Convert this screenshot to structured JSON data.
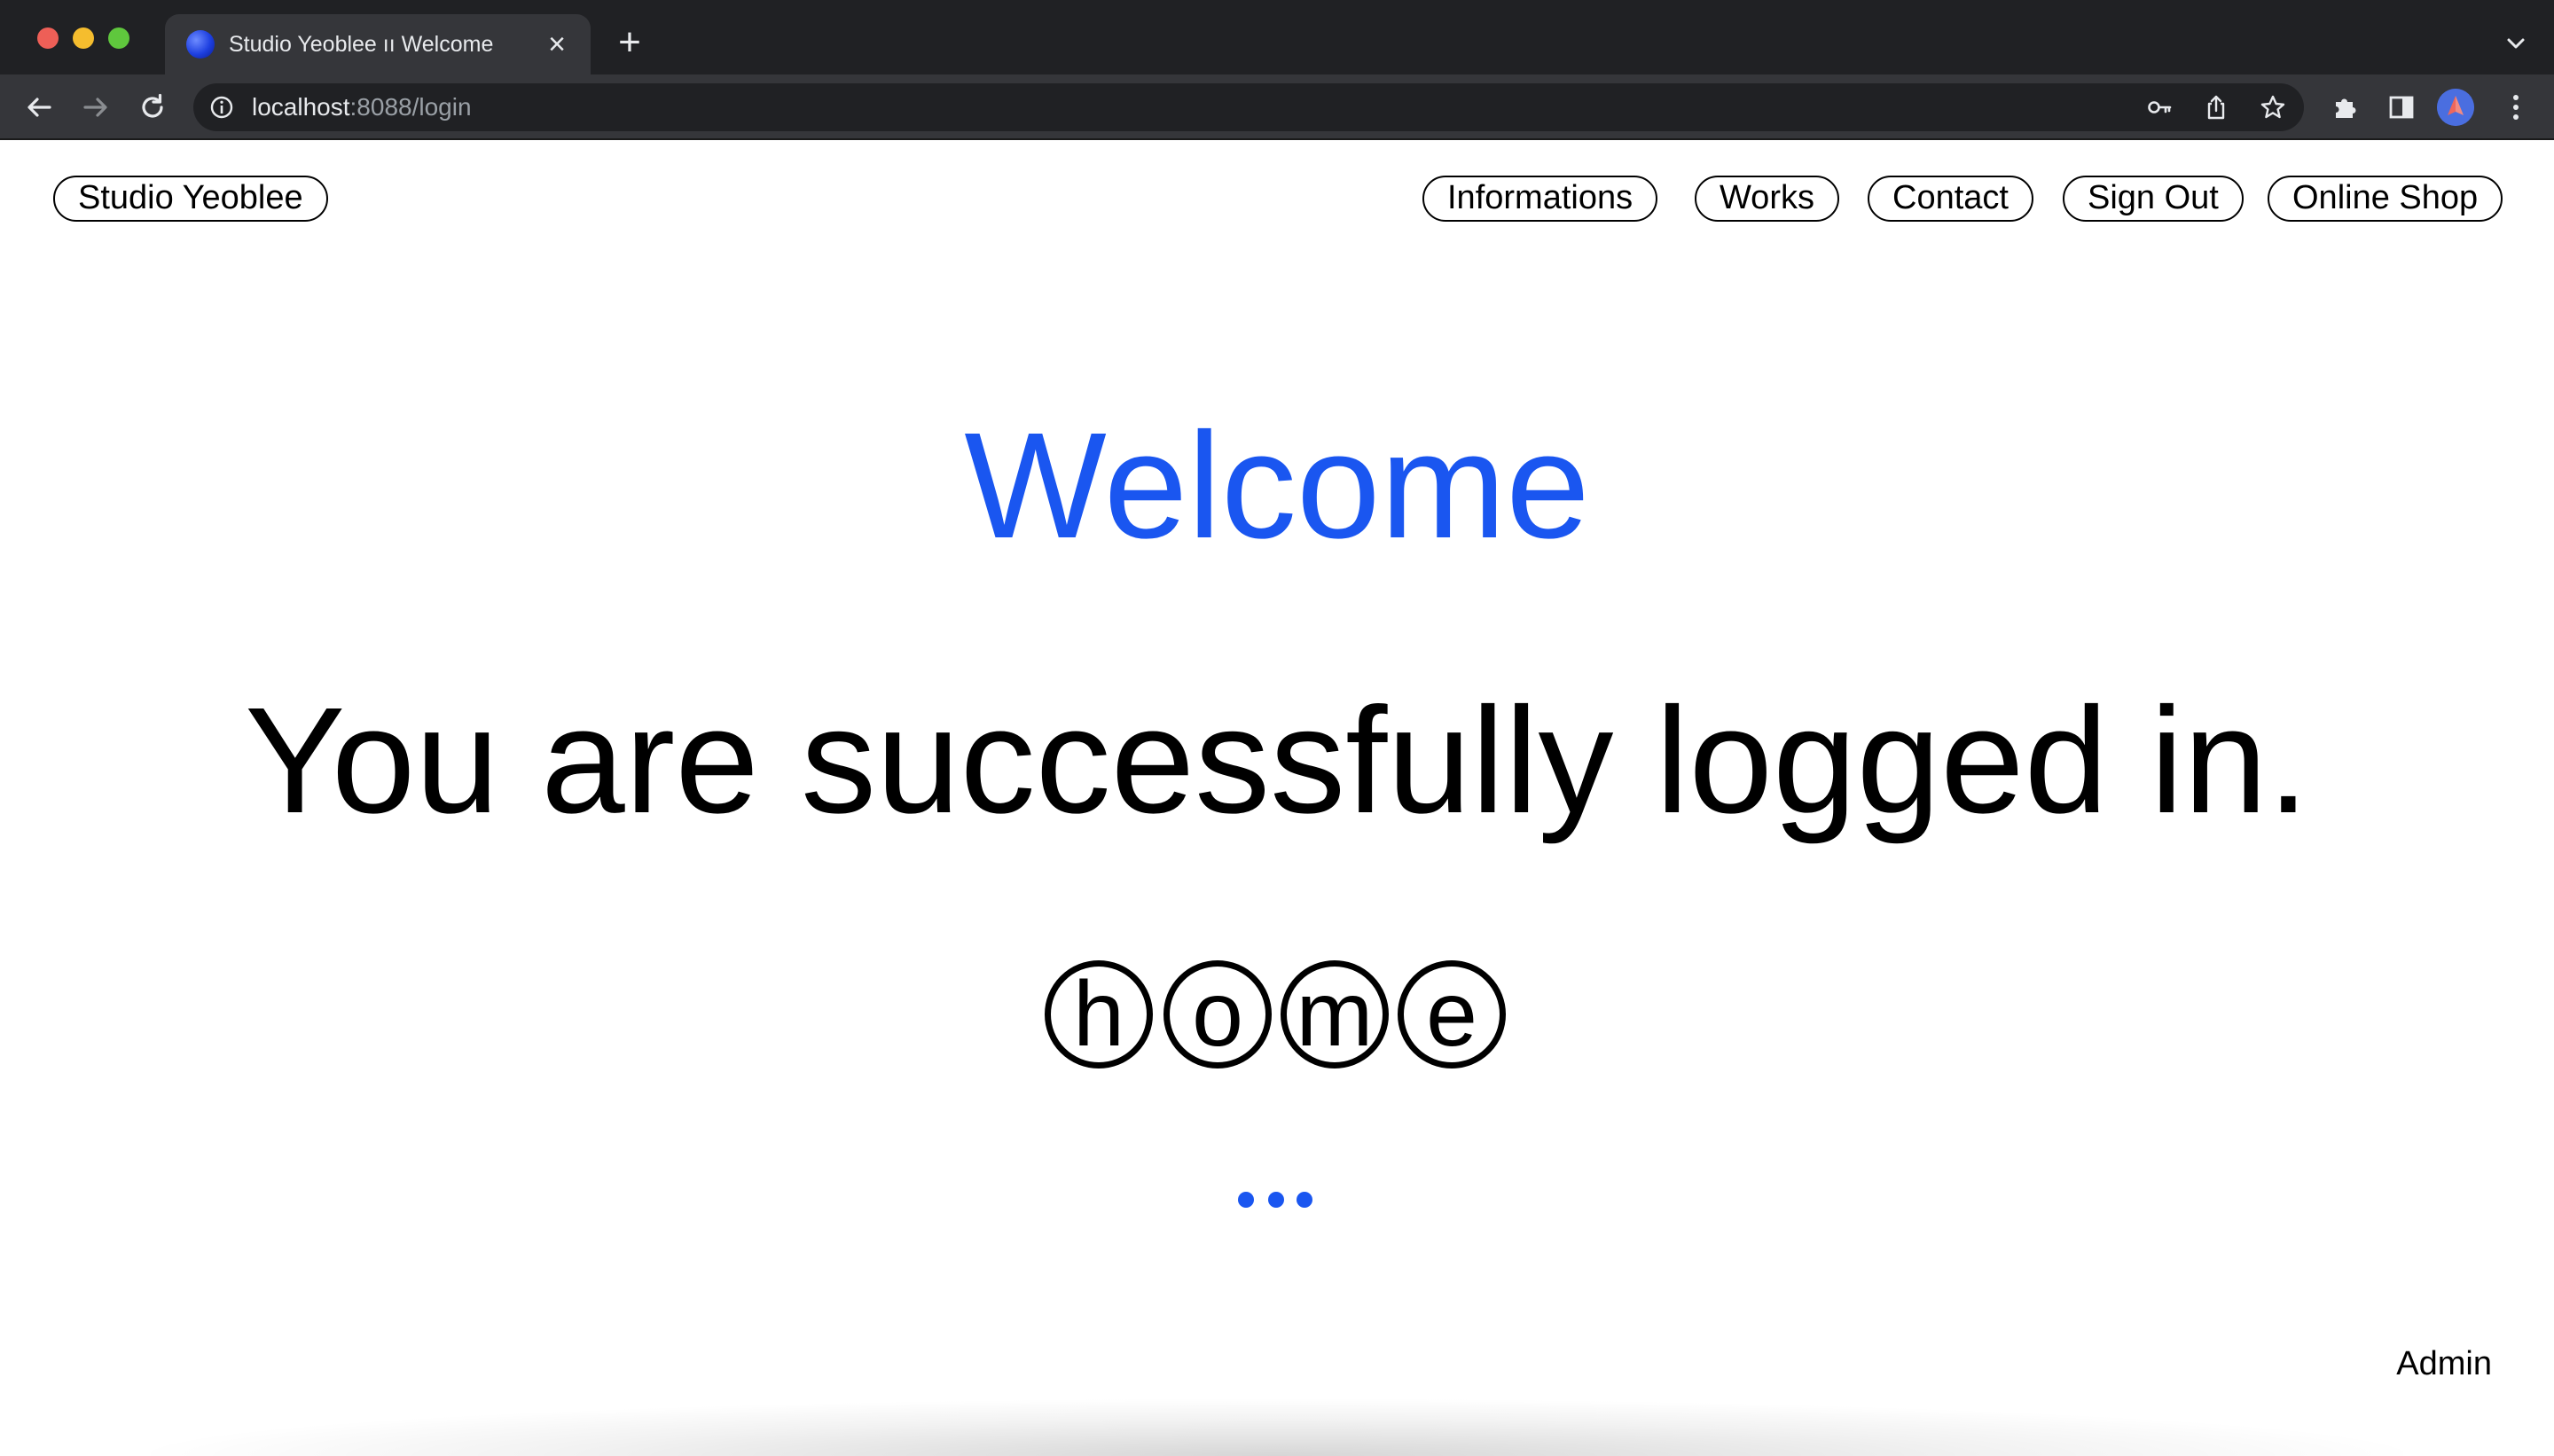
{
  "browser": {
    "tab_title": "Studio Yeoblee ıı Welcome",
    "url_host": "localhost",
    "url_path": ":8088/login",
    "colors": {
      "tabbar": "#202124",
      "toolbar": "#35363a",
      "omnibox": "#202124",
      "text": "#e8eaed"
    },
    "icons": [
      "globe-favicon-icon",
      "close-icon",
      "plus-icon",
      "chevron-down-icon",
      "back-arrow-icon",
      "forward-arrow-icon",
      "reload-icon",
      "info-icon",
      "key-icon",
      "share-icon",
      "star-icon",
      "puzzle-icon",
      "side-panel-icon",
      "profile-avatar",
      "kebab-menu-icon"
    ]
  },
  "site": {
    "brand": "Studio Yeoblee",
    "nav": [
      "Informations",
      "Works",
      "Contact",
      "Sign Out",
      "Online Shop"
    ],
    "heading": "Welcome",
    "message": "You are successfully logged in.",
    "home_letters": [
      "h",
      "o",
      "m",
      "e"
    ],
    "footer_user": "Admin",
    "colors": {
      "accent": "#1a56f0",
      "text": "#000000",
      "background": "#ffffff"
    }
  }
}
